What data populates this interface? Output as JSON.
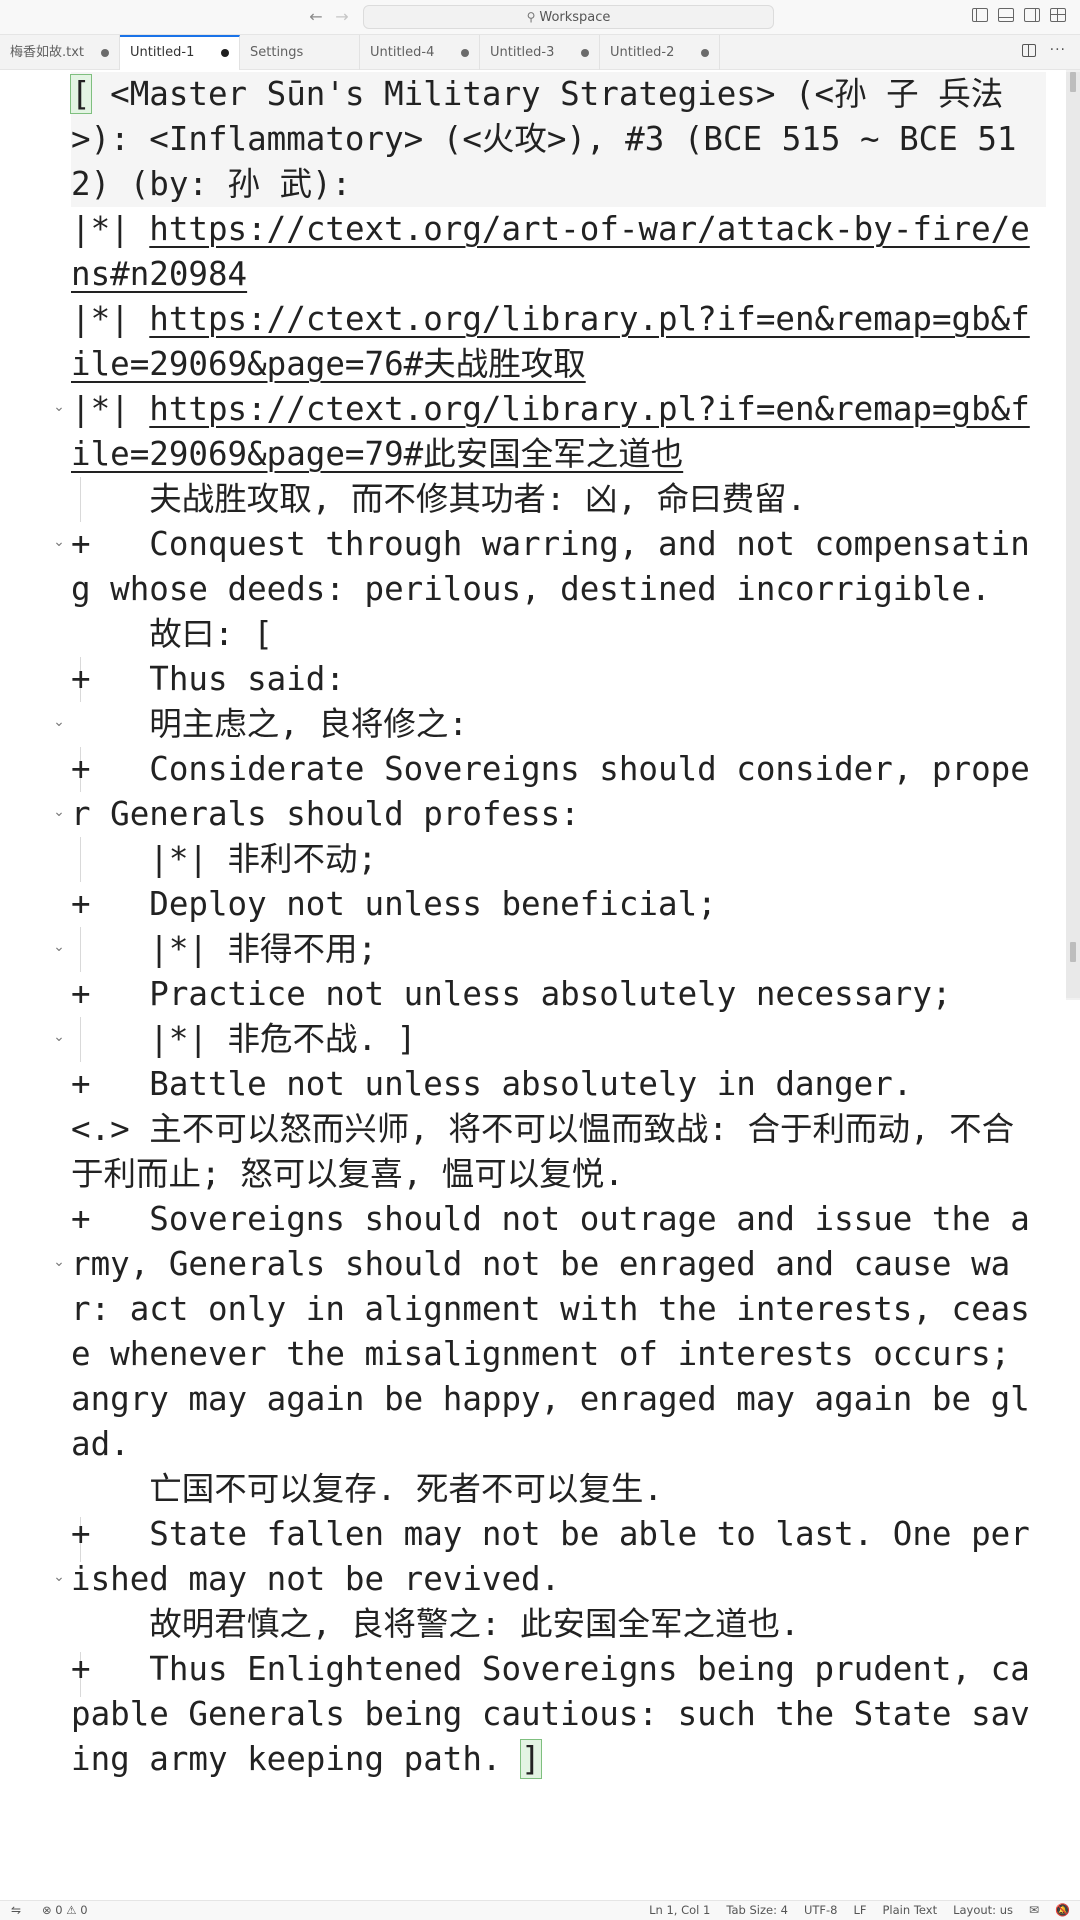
{
  "titlebar": {
    "back_icon": "arrow-left-icon",
    "forward_icon": "arrow-right-icon",
    "command_center": "Workspace",
    "layout_icons": [
      "toggle-primary-sidebar-icon",
      "toggle-panel-icon",
      "toggle-secondary-sidebar-icon",
      "customize-layout-icon"
    ]
  },
  "tabs": [
    {
      "label": "梅香如故.txt",
      "dirty": true,
      "active": false
    },
    {
      "label": "Untitled-1",
      "dirty": true,
      "active": true
    },
    {
      "label": "Settings",
      "dirty": false,
      "active": false
    },
    {
      "label": "Untitled-4",
      "dirty": true,
      "active": false
    },
    {
      "label": "Untitled-3",
      "dirty": true,
      "active": false
    },
    {
      "label": "Untitled-2",
      "dirty": true,
      "active": false
    }
  ],
  "editor": {
    "lines": [
      "[ <Master Sūn's Military Strategies> (<孙 子 兵法>): <Inflammatory> (<火攻>), #3 (BCE 515 ~ BCE 512) (by: 孙 武):",
      {
        "prefix": "|*| ",
        "link": "https://ctext.org/art-of-war/attack-by-fire/ens#n20984"
      },
      {
        "prefix": "|*| ",
        "link": "https://ctext.org/library.pl?if=en&remap=gb&file=29069&page=76#夫战胜攻取"
      },
      {
        "prefix": "|*| ",
        "link": "https://ctext.org/library.pl?if=en&remap=gb&file=29069&page=79#此安国全军之道也"
      },
      "    夫战胜攻取, 而不修其功者: 凶, 命曰费留.",
      "+   Conquest through warring, and not compensating whose deeds: perilous, destined incorrigible.",
      "    故曰: [",
      "+   Thus said:",
      "    明主虑之, 良将修之:",
      "+   Considerate Sovereigns should consider, proper Generals should profess:",
      "    |*| 非利不动;",
      "+   Deploy not unless beneficial;",
      "    |*| 非得不用;",
      "+   Practice not unless absolutely necessary;",
      "    |*| 非危不战. ]",
      "+   Battle not unless absolutely in danger.",
      "<.> 主不可以怒而兴师, 将不可以愠而致战: 合于利而动, 不合于利而止; 怒可以复喜, 愠可以复悦.",
      "+   Sovereigns should not outrage and issue the army, Generals should not be enraged and cause war: act only in alignment with the interests, cease whenever the misalignment of interests occurs; angry may again be happy, enraged may again be glad.",
      "    亡国不可以复存. 死者不可以复生.",
      "+   State fallen may not be able to last. One perished may not be revived.",
      "    故明君慎之, 良将警之: 此安国全军之道也.",
      "+   Thus Enlightened Sovereigns being prudent, capable Generals being cautious: such the State saving army keeping path. ]"
    ]
  },
  "statusbar": {
    "remote_icon": "remote-icon",
    "problems": "⊗ 0 ⚠ 0",
    "position": "Ln 1, Col 1",
    "tab_size": "Tab Size: 4",
    "encoding": "UTF-8",
    "eol": "LF",
    "language": "Plain Text",
    "layout": "Layout: us",
    "feedback_icon": "feedback-icon",
    "notifications_icon": "bell-slash-icon"
  }
}
